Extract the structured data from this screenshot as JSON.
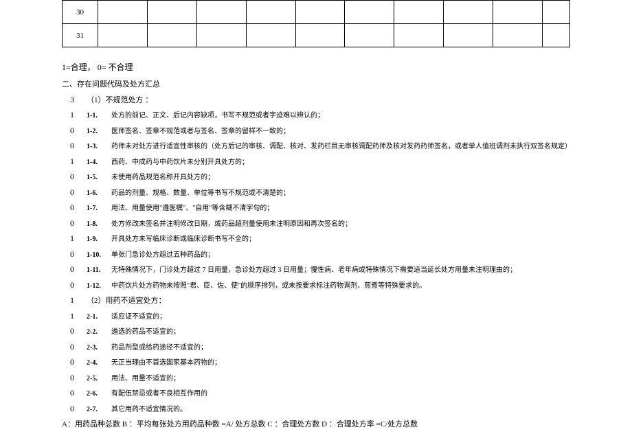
{
  "table": {
    "rows": [
      "30",
      "31"
    ],
    "colCount": 11
  },
  "legend": "1=合理，  0= 不合理",
  "sectionTitle": "二、存在问题代码及处方汇总",
  "codes": [
    {
      "count": "3",
      "label": "（1）不规范处方    ：",
      "text": "",
      "isHeader": true
    },
    {
      "count": "1",
      "label": "1-1.",
      "text": "处方的前记、正文、后记内容缺项，书写不规范或者字迹难以辨认的；"
    },
    {
      "count": "0",
      "label": "1-2.",
      "text": "医师签名、签章不规范或者与签名、签章的留样不一致的；"
    },
    {
      "count": "0",
      "label": "1-3.",
      "text": "药师未对处方进行适宜性审核的（处方后记的审核、调配、核对、发药栏目无审核调配药师及核对发药药师签名，或者单人值班调剂未执行双签名规定）"
    },
    {
      "count": "1",
      "label": "1-4.",
      "text": "西药、中成药与中药饮片未分别开具处方的；"
    },
    {
      "count": "0",
      "label": "1-5.",
      "text": "未使用药品规范名称开具处方的；"
    },
    {
      "count": "0",
      "label": "1-6.",
      "text": "药品的剂量、规格、数量、单位等书写不规范或不清楚的；"
    },
    {
      "count": "0",
      "label": "1-7.",
      "text": "用法、用量使用\"遵医嘱\"、\"自用\"等含糊不清字句的；"
    },
    {
      "count": "0",
      "label": "1-8.",
      "text": "处方修改未签名并注明修改日期，或药品超剂量使用未注明原因和再次签名的；"
    },
    {
      "count": "1",
      "label": "1-9.",
      "text": "开具处方未写临床诊断或临床诊断书写不全的；"
    },
    {
      "count": "0",
      "label": "1-10.",
      "text": "单张门急诊处方超过五种药品的；"
    },
    {
      "count": "0",
      "label": "1-11.",
      "text": "无特殊情况下，门诊处方超过     7 日用量，急诊处方超过      3 日用量；慢性病、老年病或特殊情况下需要适当延长处方用量未注明理由的；"
    },
    {
      "count": "0",
      "label": "1-12.",
      "text": "中药饮片处方药物未按照\"君、臣、佐、使\"的顺序排列，或未按要求标注药物调剂、煎煮等特殊要求的。"
    },
    {
      "count": "1",
      "label": "（2）用药不适宜处方：",
      "text": "",
      "isHeader": true
    },
    {
      "count": "1",
      "label": "2-1.",
      "text": "适应证不适宜的；"
    },
    {
      "count": "0",
      "label": "2-2.",
      "text": "遴选的药品不适宜的；"
    },
    {
      "count": "0",
      "label": "2-3.",
      "text": "药品剂型或给药途径不适宜的；"
    },
    {
      "count": "0",
      "label": "2-4.",
      "text": "无正当理由不首选国家基本药物的；"
    },
    {
      "count": "0",
      "label": "2-5.",
      "text": "用法、用量不适宜的；"
    },
    {
      "count": "0",
      "label": "2-6.",
      "text": " 有配伍禁忌或者不良相互作用的"
    },
    {
      "count": "0",
      "label": "2-7.",
      "text": " 其它用药不适宜情况的。"
    }
  ],
  "footer": "A：用药品种总数   B ：平均每张处方用药品种数       =A/ 处方总数  C ：合理处方数   D ：合理处方率   =C/处方总数"
}
